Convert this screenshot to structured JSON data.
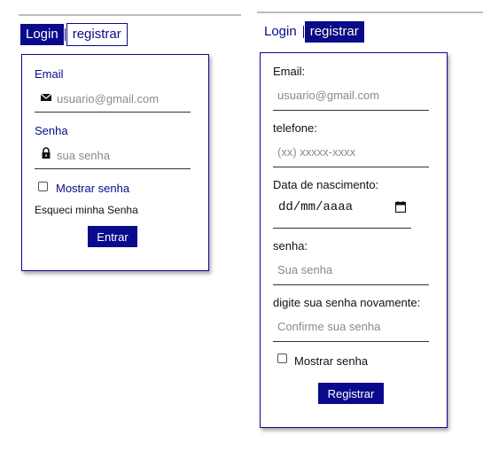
{
  "login_panel": {
    "tabs": {
      "login": "Login",
      "register": "registrar"
    },
    "email_label": "Email",
    "email_placeholder": "usuario@gmail.com",
    "password_label": "Senha",
    "password_placeholder": "sua senha",
    "show_password": "Mostrar senha",
    "forgot_password": "Esqueci minha Senha",
    "submit": "Entrar"
  },
  "register_panel": {
    "tabs": {
      "login": "Login",
      "register": "registrar"
    },
    "email_label": "Email:",
    "email_placeholder": "usuario@gmail.com",
    "phone_label": "telefone:",
    "phone_placeholder": "(xx) xxxxx-xxxx",
    "birth_label": "Data de nascimento:",
    "birth_value": "dd/mm/aaaa",
    "password_label": "senha:",
    "password_placeholder": "Sua senha",
    "confirm_label": "digite sua senha novamente:",
    "confirm_placeholder": "Confirme sua senha",
    "show_password": "Mostrar senha",
    "submit": "Registrar"
  },
  "colors": {
    "accent": "#0a0a8c",
    "divider": "#bdbdbd"
  },
  "icons": {
    "email": "envelope-icon",
    "password": "lock-icon",
    "date": "calendar-icon"
  }
}
